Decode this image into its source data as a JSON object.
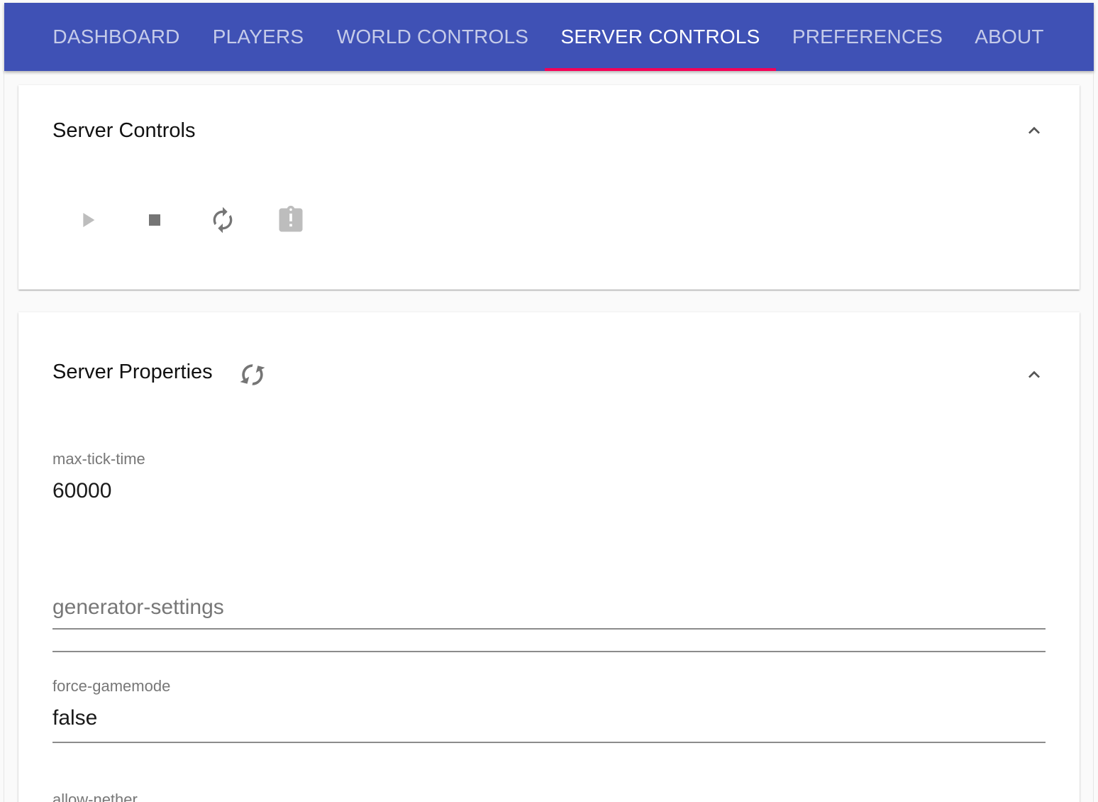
{
  "tabs": [
    {
      "label": "DASHBOARD",
      "active": false
    },
    {
      "label": "PLAYERS",
      "active": false
    },
    {
      "label": "WORLD CONTROLS",
      "active": false
    },
    {
      "label": "SERVER CONTROLS",
      "active": true
    },
    {
      "label": "PREFERENCES",
      "active": false
    },
    {
      "label": "ABOUT",
      "active": false
    }
  ],
  "colors": {
    "appbar": "#3f51b5",
    "indicator": "#f50057",
    "icon": "#757575",
    "icon_disabled": "#bdbdbd"
  },
  "server_controls": {
    "title": "Server Controls",
    "expanded": true,
    "collapse_icon": "chevron-up-icon",
    "buttons": [
      {
        "icon": "play-icon",
        "enabled": false
      },
      {
        "icon": "stop-icon",
        "enabled": true
      },
      {
        "icon": "restart-icon",
        "enabled": true
      },
      {
        "icon": "clipboard-alert-icon",
        "enabled": false
      }
    ]
  },
  "server_properties": {
    "title": "Server Properties",
    "refresh_icon": "sync-icon",
    "expanded": true,
    "collapse_icon": "chevron-up-icon",
    "fields": [
      {
        "label": "max-tick-time",
        "value": "60000",
        "placeholder": ""
      },
      {
        "label": "",
        "value": "",
        "placeholder": "generator-settings"
      },
      {
        "label": "force-gamemode",
        "value": "false",
        "placeholder": ""
      },
      {
        "label": "allow-nether",
        "value": "",
        "placeholder": ""
      }
    ]
  }
}
